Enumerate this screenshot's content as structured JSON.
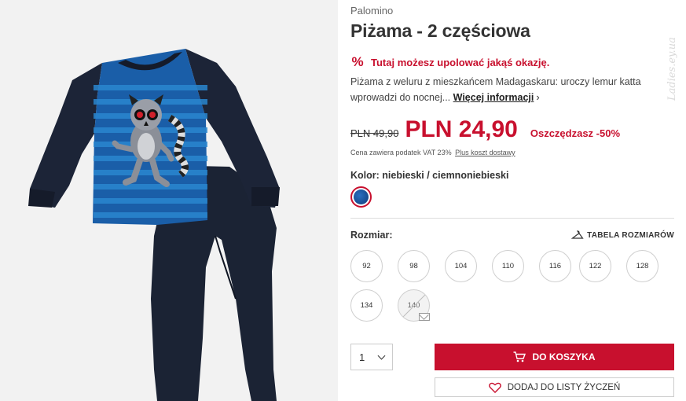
{
  "product": {
    "brand": "Palomino",
    "title": "Piżama - 2 częściowa",
    "promo": "Tutaj możesz upolować jakąś okazję.",
    "promo_icon": "percent-icon",
    "description": "Piżama z weluru z mieszkańcem Madagaskaru: uroczy lemur katta wprowadzi do nocnej...",
    "more_link": "Więcej informacji",
    "old_price": "PLN 49,90",
    "new_price": "PLN 24,90",
    "saving": "Oszczędzasz -50%",
    "vat_note": "Cena zawiera podatek VAT 23%",
    "shipping_link": "Plus koszt dostawy"
  },
  "color": {
    "label": "Kolor: niebieski / ciemnoniebieski",
    "swatch_color": "#1a4f9c"
  },
  "sizes": {
    "label": "Rozmiar:",
    "guide_label": "TABELA ROZMIARÓW",
    "options": [
      "92",
      "98",
      "104",
      "110",
      "116",
      "122",
      "128",
      "134",
      "140"
    ],
    "unavailable": "140"
  },
  "purchase": {
    "quantity": "1",
    "add_to_cart": "DO KOSZYKA",
    "wishlist": "DODAJ DO LISTY ŻYCZEŃ"
  },
  "colors": {
    "accent": "#c8102e",
    "text": "#333333"
  },
  "watermark": "Ladies.ey.ua"
}
